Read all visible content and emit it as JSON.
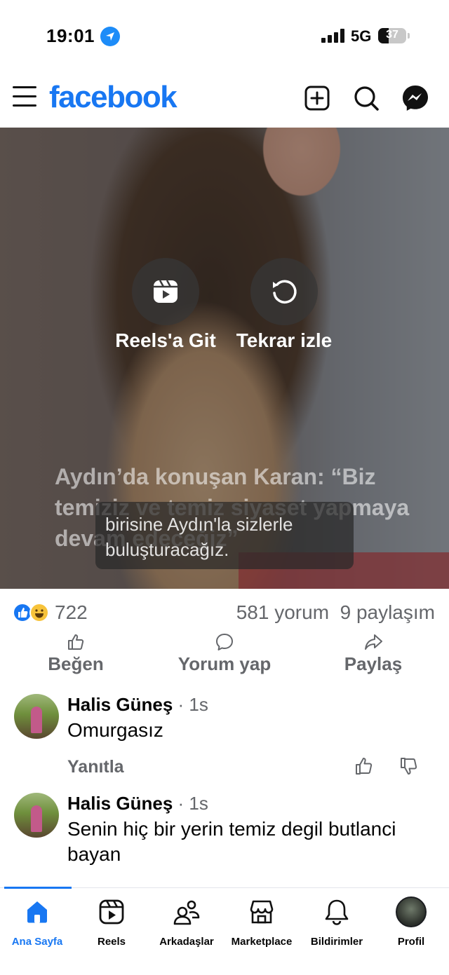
{
  "status_bar": {
    "time": "19:01",
    "network": "5G",
    "battery": "37"
  },
  "header": {
    "logo": "facebook",
    "icons": [
      "menu-icon",
      "create-post-icon",
      "search-icon",
      "messenger-icon"
    ]
  },
  "video": {
    "reels_button": "Reels'a Git",
    "replay_button": "Tekrar izle",
    "headline": "Aydın’da konuşan Karan: “Biz temiziz ve temiz siyaset yapmaya devam edeceğiz”",
    "subtitle": "birisine Aydın'la sizlerle buluşturacağız."
  },
  "stats": {
    "reactions": "722",
    "comments": "581 yorum",
    "shares": "9 paylaşım"
  },
  "actions": {
    "like": "Beğen",
    "comment": "Yorum yap",
    "share": "Paylaş"
  },
  "comments": [
    {
      "author": "Halis Güneş",
      "time": "· 1s",
      "text": "Omurgasız",
      "reply": "Yanıtla"
    },
    {
      "author": "Halis Güneş",
      "time": "· 1s",
      "text": "Senin hiç bir yerin temiz degil butlanci bayan"
    }
  ],
  "bottom_nav": [
    {
      "label": "Ana Sayfa",
      "icon": "home-icon",
      "active": true
    },
    {
      "label": "Reels",
      "icon": "reels-icon"
    },
    {
      "label": "Arkadaşlar",
      "icon": "friends-icon"
    },
    {
      "label": "Marketplace",
      "icon": "marketplace-icon"
    },
    {
      "label": "Bildirimler",
      "icon": "bell-icon"
    },
    {
      "label": "Profil",
      "icon": "profile-avatar"
    }
  ],
  "colors": {
    "brand": "#1877f2",
    "secondary_text": "#65676b"
  }
}
